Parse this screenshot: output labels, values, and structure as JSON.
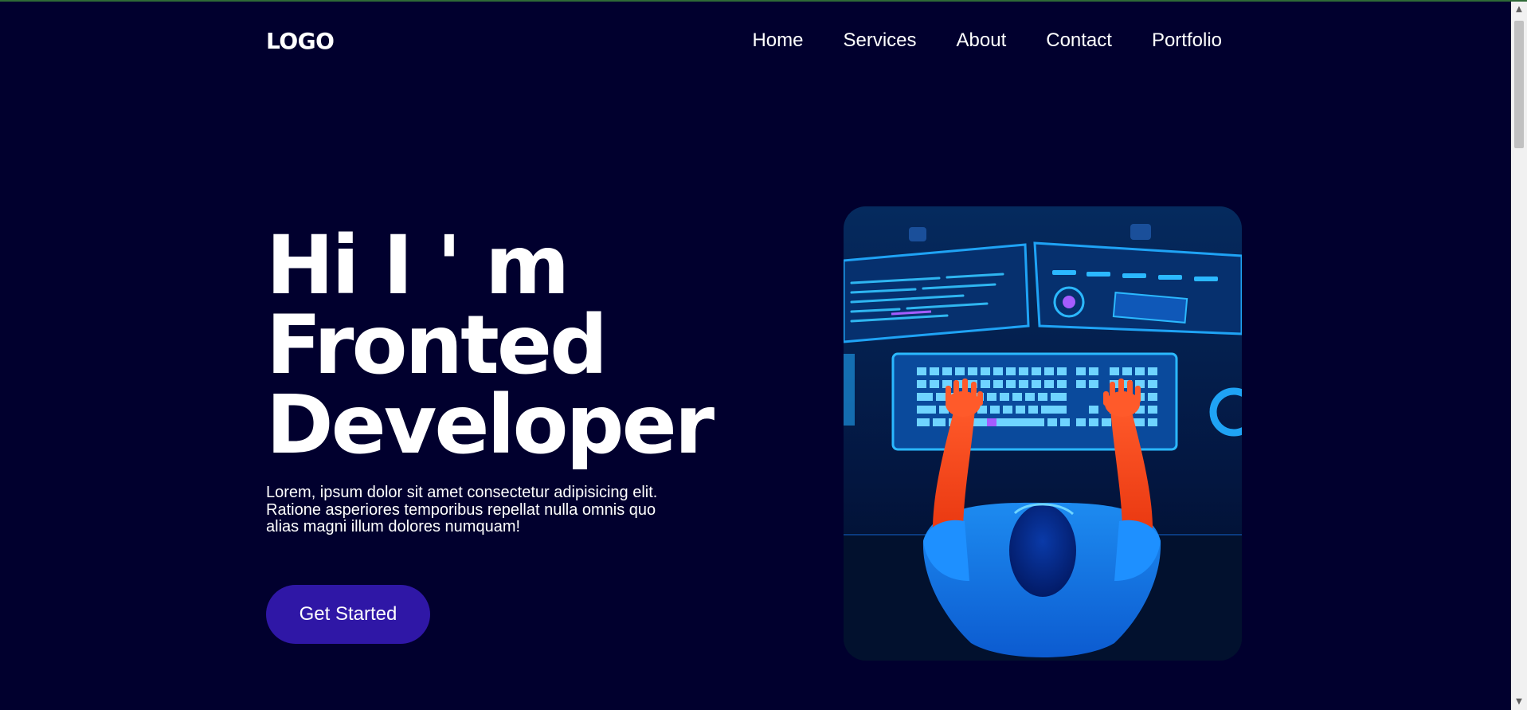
{
  "header": {
    "logo": "LOGO",
    "nav": [
      "Home",
      "Services",
      "About",
      "Contact",
      "Portfolio"
    ]
  },
  "hero": {
    "title_lines": [
      "Hi I ' m",
      "Fronted",
      "Developer"
    ],
    "description": "Lorem, ipsum dolor sit amet consectetur adipisicing elit. Ratione asperiores temporibus repellat nulla omnis quo alias magni illum dolores numquam!",
    "cta_label": "Get Started"
  },
  "colors": {
    "background": "#01002e",
    "button": "#2f17a6",
    "text": "#ffffff"
  },
  "icons": {
    "scroll_up": "scroll-up-arrow-icon",
    "scroll_down": "scroll-down-arrow-icon"
  }
}
